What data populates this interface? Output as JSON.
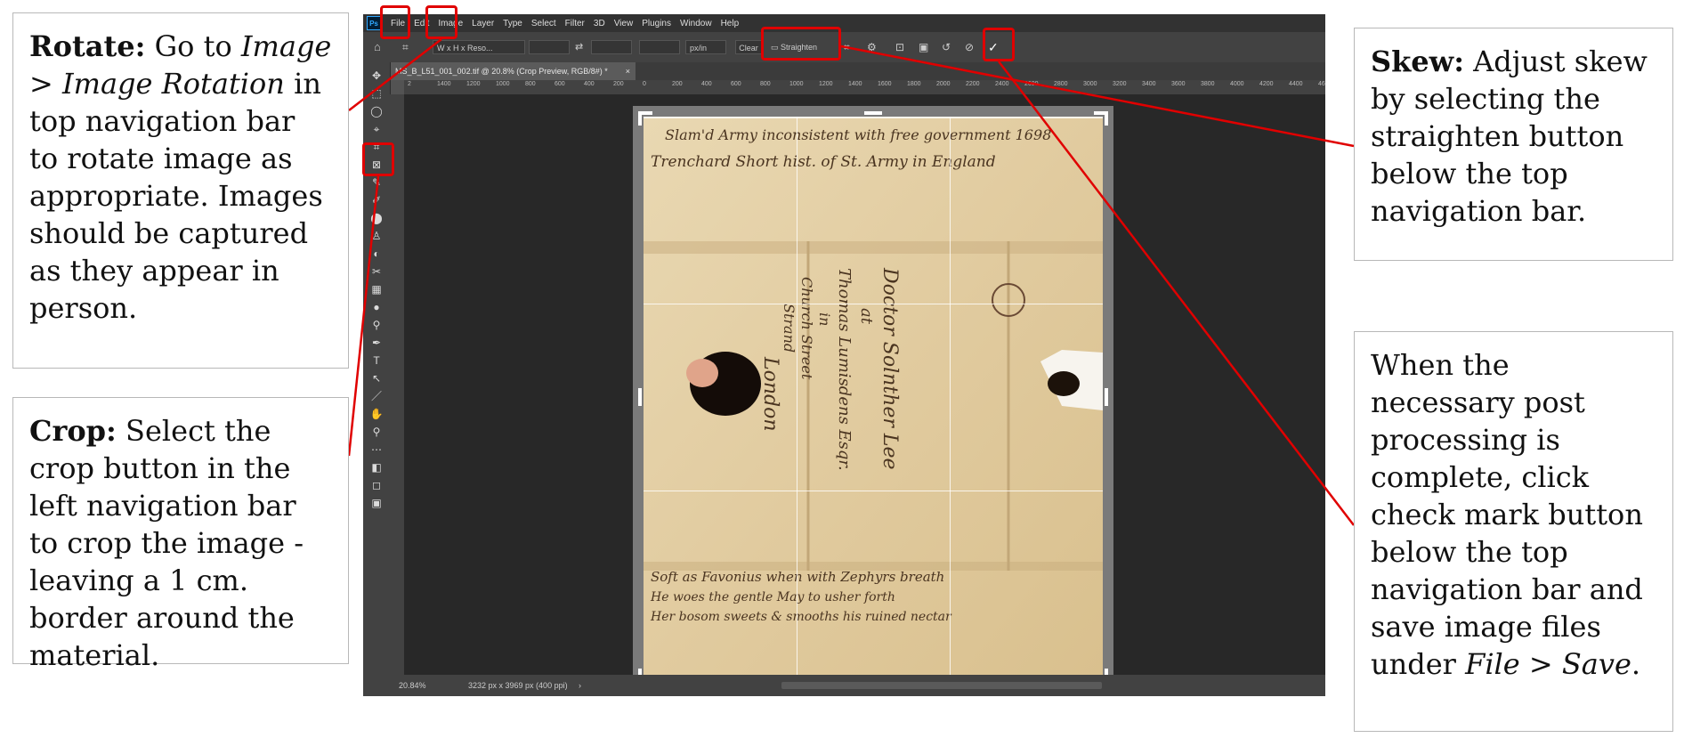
{
  "callouts": {
    "rotate": {
      "title": "Rotate:",
      "t1": " Go to ",
      "italic": "Image > Image Rotation",
      "t2": " in top navigation bar to rotate image as appropriate. Images should be captured as they appear in person."
    },
    "crop": {
      "title": "Crop:",
      "text": " Select the crop button in the left navigation bar to crop the image - leaving a 1 cm. border around the material."
    },
    "skew": {
      "title": "Skew:",
      "text": "  Adjust skew by selecting the straighten button below the top navigation bar."
    },
    "check": {
      "t1": "When the necessary post processing is complete, click check mark button below the top navigation bar and save image files under ",
      "italic": "File > Save",
      "t2": "."
    }
  },
  "photoshop": {
    "logo": "Ps",
    "menu": [
      "File",
      "Edit",
      "Image",
      "Layer",
      "Type",
      "Select",
      "Filter",
      "3D",
      "View",
      "Plugins",
      "Window",
      "Help"
    ],
    "options": {
      "ratio": "W x H x Reso...",
      "units": "px/in",
      "clear": "Clear",
      "straighten": "Straighten",
      "commit": "✓"
    },
    "doc_tab": "MS_B_L51_001_002.tif @ 20.8% (Crop Preview, RGB/8#) *",
    "ruler_ticks": [
      "2",
      "1400",
      "1200",
      "1000",
      "800",
      "600",
      "400",
      "200",
      "0",
      "200",
      "400",
      "600",
      "800",
      "1000",
      "1200",
      "1400",
      "1600",
      "1800",
      "2000",
      "2200",
      "2400",
      "2600",
      "2800",
      "3000",
      "3200",
      "3400",
      "3600",
      "3800",
      "4000",
      "4200",
      "4400",
      "4600"
    ],
    "status": {
      "zoom": "20.84%",
      "size": "3232 px x 3969 px (400 ppi)"
    },
    "tools": [
      "✥",
      "⬚",
      "◯",
      "⌖",
      "⌗",
      "⊠",
      "✎",
      "✐",
      "⬤",
      "♙",
      "◐",
      "✂",
      "▦",
      "●",
      "⚲",
      "✒",
      "T",
      "↖",
      "／",
      "✋",
      "⚲",
      "⋯",
      "◧",
      "◻",
      "▣"
    ]
  },
  "manuscript": {
    "line1": "Slam'd Army inconsistent with free government 1698",
    "line2": "Trenchard Short hist. of St. Army in England",
    "address1": "Doctor Solnther Lee",
    "address2": "at",
    "address3": "Thomas Lumisdens Esqr.",
    "address4": "in",
    "address5": "Church Street",
    "address6": "Strand",
    "address7": "London",
    "bottom1": "Soft as Favonius when with Zephyrs breath",
    "bottom2": "He woes the gentle May to usher forth",
    "bottom3": "Her bosom sweets & smooths his ruined nectar"
  },
  "colors": {
    "highlight": "#e00000",
    "paper": "#e3cfa6",
    "ink": "#4a3420"
  }
}
